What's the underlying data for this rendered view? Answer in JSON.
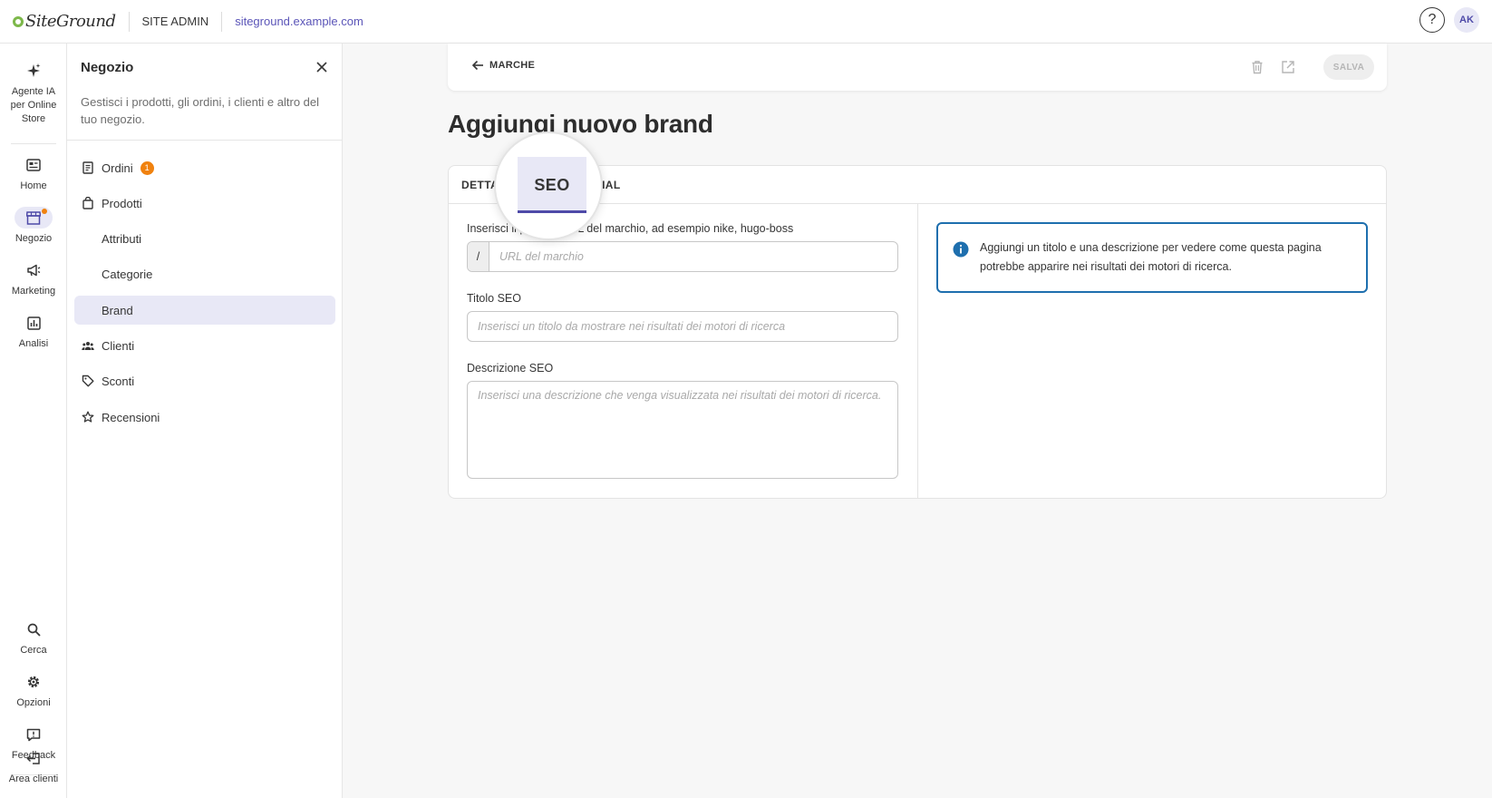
{
  "topbar": {
    "logo_text": "SiteGround",
    "site_admin": "SITE ADMIN",
    "site_url": "siteground.example.com",
    "help_label": "?",
    "avatar_initials": "AK"
  },
  "rail": {
    "items": [
      {
        "label": "Agente IA per Online Store",
        "icon": "sparkles-icon"
      },
      {
        "label": "Home",
        "icon": "home-icon"
      },
      {
        "label": "Negozio",
        "icon": "store-icon",
        "active": true
      },
      {
        "label": "Marketing",
        "icon": "megaphone-icon"
      },
      {
        "label": "Analisi",
        "icon": "chart-icon"
      },
      {
        "label": "Cerca",
        "icon": "search-icon"
      },
      {
        "label": "Opzioni",
        "icon": "gear-icon"
      },
      {
        "label": "Feedback",
        "icon": "feedback-icon"
      },
      {
        "label": "Area clienti",
        "icon": "logout-icon"
      }
    ]
  },
  "panel": {
    "title": "Negozio",
    "description": "Gestisci i prodotti, gli ordini, i clienti e altro del tuo negozio.",
    "items": [
      {
        "label": "Ordini",
        "badge": "1"
      },
      {
        "label": "Prodotti"
      },
      {
        "label": "Attributi"
      },
      {
        "label": "Categorie"
      },
      {
        "label": "Brand",
        "active": true
      },
      {
        "label": "Clienti"
      },
      {
        "label": "Sconti"
      },
      {
        "label": "Recensioni"
      }
    ]
  },
  "toolbar": {
    "back_label": "MARCHE",
    "save_label": "SALVA"
  },
  "page": {
    "title": "Aggiungi nuovo brand"
  },
  "tabs": {
    "dettagli": "DETTA",
    "seo": "SEO",
    "social": "CIAL"
  },
  "form": {
    "url_label_start": "Inserisci il p",
    "url_label_end": "RL del marchio, ad esempio nike, hugo-boss",
    "url_prefix": "/",
    "url_placeholder": "URL del marchio",
    "seo_title_label": "Titolo SEO",
    "seo_title_placeholder": "Inserisci un titolo da mostrare nei risultati dei motori di ricerca",
    "seo_desc_label": "Descrizione SEO",
    "seo_desc_placeholder": "Inserisci una descrizione che venga visualizzata nei risultati dei motori di ricerca."
  },
  "info": {
    "text": "Aggiungi un titolo e una descrizione per vedere come questa pagina potrebbe apparire nei risultati dei motori di ricerca."
  },
  "colors": {
    "accent": "#4e4aa8",
    "active_bg": "#e8e8f6",
    "badge": "#f0820f",
    "info_border": "#1e6fae",
    "logo_green": "#7db84a"
  }
}
